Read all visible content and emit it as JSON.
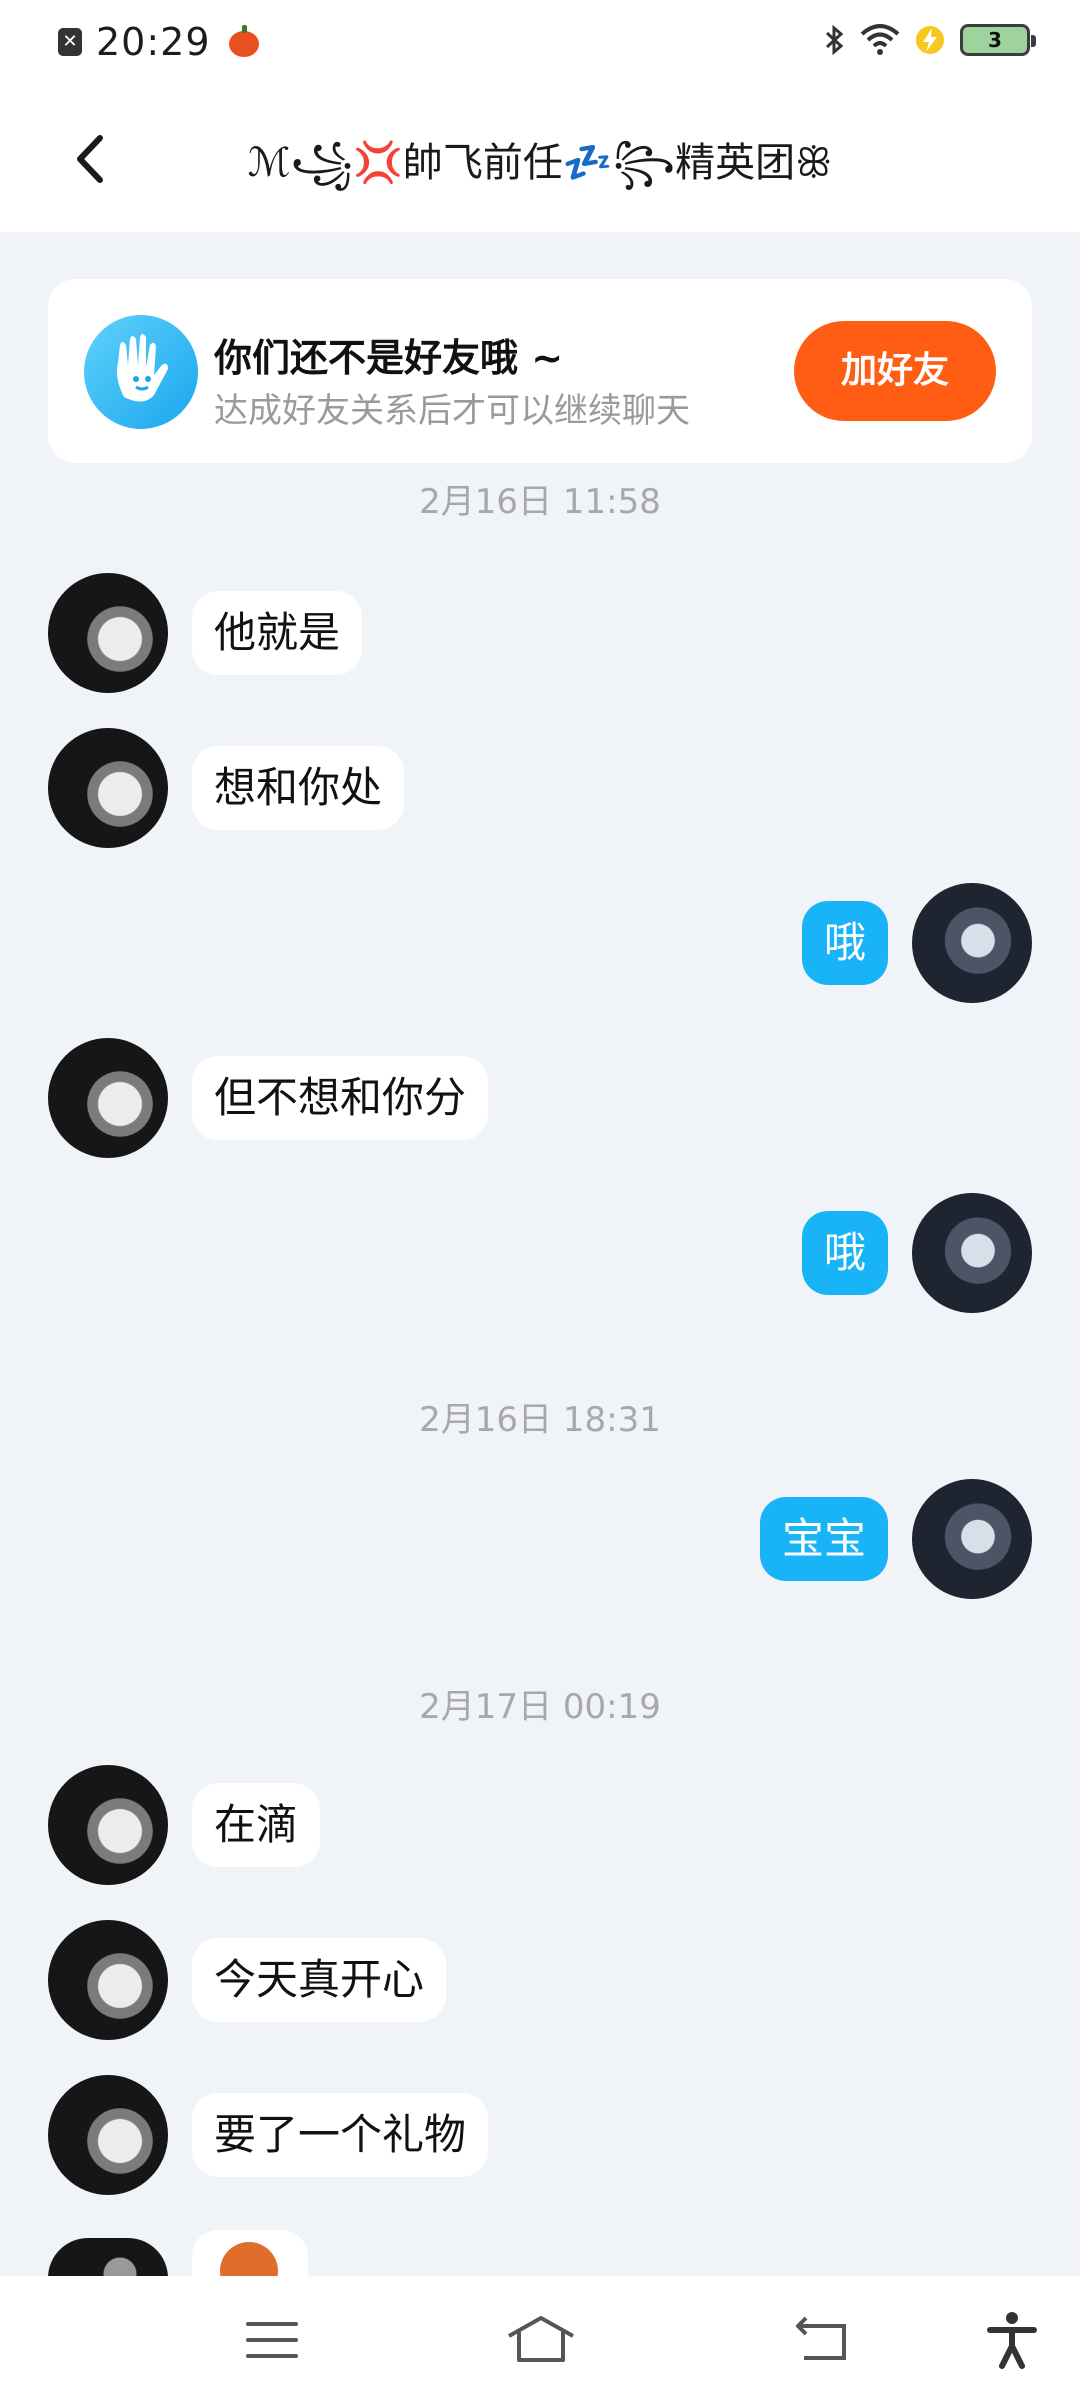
{
  "status_bar": {
    "time": "20:29",
    "notification_icon": "close-box-icon",
    "decoration_icon": "pumpkin-icon",
    "icons": [
      "bluetooth-icon",
      "wifi-icon",
      "charging-icon"
    ],
    "battery_level": "3"
  },
  "header": {
    "back_icon": "chevron-left-icon",
    "title": "ℳ꧁💢帥飞前任💤꧂精英团ꕥ"
  },
  "friend_card": {
    "icon": "hand-wave-icon",
    "title": "你们还不是好友哦 ~",
    "subtitle": "达成好友关系后才可以继续聊天",
    "button_label": "加好友"
  },
  "chat": {
    "partial_timestamp": "2月16日  11:58",
    "messages": [
      {
        "side": "left",
        "text": "他就是"
      },
      {
        "side": "left",
        "text": "想和你处"
      },
      {
        "side": "right",
        "text": "哦"
      },
      {
        "side": "left",
        "text": "但不想和你分"
      },
      {
        "side": "right",
        "text": "哦"
      }
    ],
    "timestamp_2": "2月16日  18:31",
    "messages_2": [
      {
        "side": "right",
        "text": "宝宝"
      }
    ],
    "timestamp_3": "2月17日  00:19",
    "messages_3": [
      {
        "side": "left",
        "text": "在滴"
      },
      {
        "side": "left",
        "text": "今天真开心"
      },
      {
        "side": "left",
        "text": "要了一个礼物"
      }
    ],
    "last_sticker": "monkey-sticker"
  },
  "nav_bar": {
    "items": [
      "menu-icon",
      "home-icon",
      "back-icon",
      "accessibility-icon"
    ]
  },
  "colors": {
    "background": "#f0f3f7",
    "bubble_sent": "#19b4f7",
    "bubble_received": "#ffffff",
    "accent_button": "#ff5d14"
  }
}
